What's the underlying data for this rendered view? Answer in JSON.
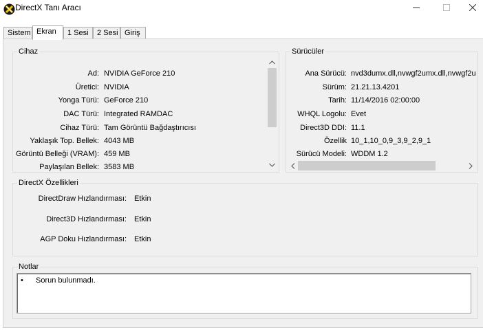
{
  "window": {
    "title": "DirectX Tanı Aracı"
  },
  "tabs": [
    {
      "label": "Sistem"
    },
    {
      "label": "Ekran"
    },
    {
      "label": "1 Sesi"
    },
    {
      "label": "2 Sesi"
    },
    {
      "label": "Giriş"
    }
  ],
  "device": {
    "title": "Cihaz",
    "rows": [
      {
        "label": "Ad:",
        "value": "NVIDIA GeForce 210"
      },
      {
        "label": "Üretici:",
        "value": "NVIDIA"
      },
      {
        "label": "Yonga Türü:",
        "value": "GeForce 210"
      },
      {
        "label": "DAC Türü:",
        "value": "Integrated RAMDAC"
      },
      {
        "label": "Cihaz Türü:",
        "value": "Tam Görüntü Bağdaştırıcısı"
      },
      {
        "label": "Yaklaşık Top. Bellek:",
        "value": "4043 MB"
      },
      {
        "label": "Görüntü Belleği (VRAM):",
        "value": "459 MB"
      },
      {
        "label": "Paylaşılan Bellek:",
        "value": "3583 MB"
      }
    ]
  },
  "drivers": {
    "title": "Sürücüler",
    "rows": [
      {
        "label": "Ana Sürücü:",
        "value": "nvd3dumx.dll,nvwgf2umx.dll,nvwgf2u"
      },
      {
        "label": "Sürüm:",
        "value": "21.21.13.4201"
      },
      {
        "label": "Tarih:",
        "value": "11/14/2016 02:00:00"
      },
      {
        "label": "WHQL Logolu:",
        "value": "Evet"
      },
      {
        "label": "Direct3D DDI:",
        "value": "11.1"
      },
      {
        "label": "Özellik",
        "value": "10_1,10_0,9_3,9_2,9_1"
      },
      {
        "label": "Sürücü Modeli:",
        "value": "WDDM 1.2"
      }
    ]
  },
  "features": {
    "title": "DirectX Özellikleri",
    "rows": [
      {
        "label": "DirectDraw Hızlandırması:",
        "value": "Etkin"
      },
      {
        "label": "Direct3D Hızlandırması:",
        "value": "Etkin"
      },
      {
        "label": "AGP Doku Hızlandırması:",
        "value": "Etkin"
      }
    ]
  },
  "notes": {
    "title": "Notlar",
    "bullet": "•",
    "text": "Sorun bulunmadı."
  }
}
